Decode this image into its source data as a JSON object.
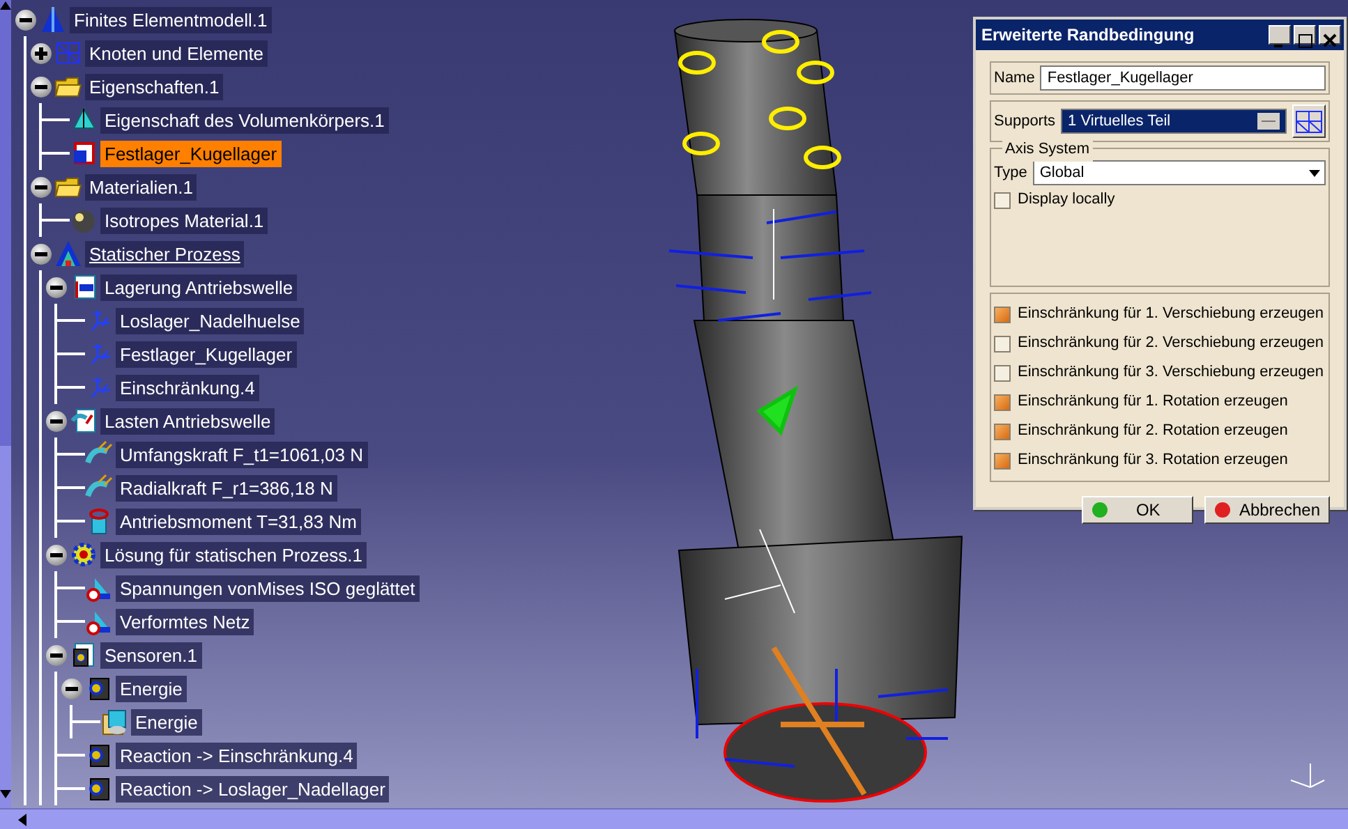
{
  "tree": [
    {
      "label": "Finites Elementmodell.1",
      "kind": "model",
      "expanded": true,
      "selected": false,
      "current": false,
      "children": [
        {
          "label": "Knoten und Elemente",
          "kind": "mesh",
          "expanded": false,
          "selected": false,
          "current": false
        },
        {
          "label": "Eigenschaften.1",
          "kind": "folder",
          "expanded": true,
          "selected": false,
          "current": false,
          "children": [
            {
              "label": "Eigenschaft des Volumenkörpers.1",
              "kind": "property",
              "selected": false,
              "current": false
            },
            {
              "label": "Festlager_Kugellager",
              "kind": "bearing",
              "selected": true,
              "current": false
            }
          ]
        },
        {
          "label": "Materialien.1",
          "kind": "folder",
          "expanded": true,
          "selected": false,
          "current": false,
          "children": [
            {
              "label": "Isotropes Material.1",
              "kind": "material",
              "selected": false,
              "current": false
            }
          ]
        },
        {
          "label": "Statischer Prozess",
          "kind": "process",
          "expanded": true,
          "selected": false,
          "current": true,
          "children": [
            {
              "label": "Lagerung Antriebswelle",
              "kind": "restraint-set",
              "expanded": true,
              "selected": false,
              "current": false,
              "children": [
                {
                  "label": "Loslager_Nadelhuelse",
                  "kind": "restraint",
                  "selected": false,
                  "current": false
                },
                {
                  "label": "Festlager_Kugellager",
                  "kind": "restraint",
                  "selected": false,
                  "current": false
                },
                {
                  "label": "Einschränkung.4",
                  "kind": "restraint",
                  "selected": false,
                  "current": false
                }
              ]
            },
            {
              "label": "Lasten Antriebswelle",
              "kind": "load-set",
              "expanded": true,
              "selected": false,
              "current": false,
              "children": [
                {
                  "label": "Umfangskraft F_t1=1061,03 N",
                  "kind": "force",
                  "selected": false,
                  "current": false
                },
                {
                  "label": "Radialkraft F_r1=386,18 N",
                  "kind": "force",
                  "selected": false,
                  "current": false
                },
                {
                  "label": "Antriebsmoment T=31,83 Nm",
                  "kind": "moment",
                  "selected": false,
                  "current": false
                }
              ]
            },
            {
              "label": "Lösung für statischen Prozess.1",
              "kind": "solution",
              "expanded": true,
              "selected": false,
              "current": false,
              "children": [
                {
                  "label": "Spannungen vonMises ISO geglättet",
                  "kind": "image",
                  "selected": false,
                  "current": false
                },
                {
                  "label": "Verformtes Netz",
                  "kind": "image",
                  "selected": false,
                  "current": false
                }
              ]
            },
            {
              "label": "Sensoren.1",
              "kind": "sensor-set",
              "expanded": true,
              "selected": false,
              "current": false,
              "children": [
                {
                  "label": "Energie",
                  "kind": "sensor",
                  "expanded": true,
                  "selected": false,
                  "current": false,
                  "children": [
                    {
                      "label": "Energie",
                      "kind": "sensor-result",
                      "selected": false,
                      "current": false
                    }
                  ]
                },
                {
                  "label": "Reaction -> Einschränkung.4",
                  "kind": "sensor",
                  "selected": false,
                  "current": false
                },
                {
                  "label": "Reaction -> Loslager_Nadellager",
                  "kind": "sensor",
                  "selected": false,
                  "current": false
                }
              ]
            }
          ]
        }
      ]
    }
  ],
  "dialog": {
    "title": "Erweiterte Randbedingung",
    "name_label": "Name",
    "name_value": "Festlager_Kugellager",
    "supports_label": "Supports",
    "supports_value": "1 Virtuelles Teil",
    "axis_group": "Axis System",
    "type_label": "Type",
    "type_value": "Global",
    "display_locally": {
      "label": "Display locally",
      "checked": false
    },
    "restraints": [
      {
        "label": "Einschränkung für 1. Verschiebung erzeugen",
        "checked": true
      },
      {
        "label": "Einschränkung für 2. Verschiebung erzeugen",
        "checked": false
      },
      {
        "label": "Einschränkung für 3. Verschiebung erzeugen",
        "checked": false
      },
      {
        "label": "Einschränkung für 1. Rotation erzeugen",
        "checked": true
      },
      {
        "label": "Einschränkung für 2. Rotation erzeugen",
        "checked": true
      },
      {
        "label": "Einschränkung für 3. Rotation erzeugen",
        "checked": true
      }
    ],
    "buttons": [
      {
        "label": "OK",
        "kind": "ok"
      },
      {
        "label": "Abbrechen",
        "kind": "cancel"
      }
    ]
  }
}
